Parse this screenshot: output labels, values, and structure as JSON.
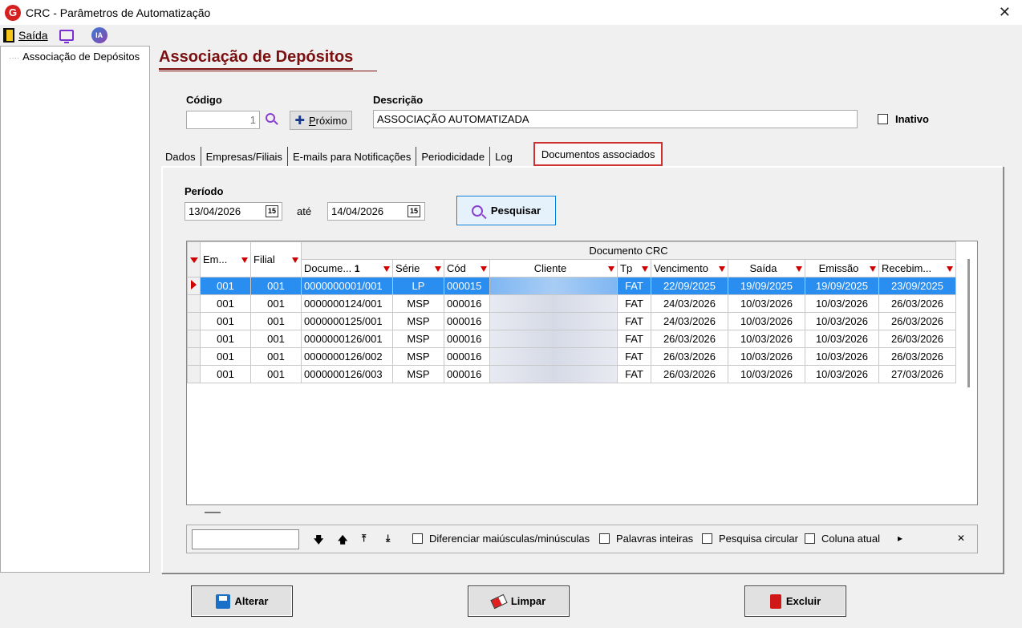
{
  "window": {
    "logo": "G",
    "title": "CRC - Parâmetros de Automatização",
    "close_glyph": "✕"
  },
  "menubar": {
    "exit_label": "Saída",
    "ia_label": "IA"
  },
  "tree": {
    "items": [
      "Associação de Depósitos"
    ]
  },
  "page_title": "Associação de Depósitos",
  "form": {
    "codigo_label": "Código",
    "codigo_value": "1",
    "proximo_label": "Próximo",
    "descricao_label": "Descrição",
    "descricao_value": "ASSOCIAÇÃO AUTOMATIZADA",
    "inativo_label": "Inativo",
    "inativo_checked": false
  },
  "tabs": [
    {
      "label": "Dados",
      "active": false
    },
    {
      "label": "Empresas/Filiais",
      "active": false
    },
    {
      "label": "E-mails para Notificações",
      "active": false
    },
    {
      "label": "Periodicidade",
      "active": false
    },
    {
      "label": "Log",
      "active": false
    },
    {
      "label": "Documentos associados",
      "active": true
    }
  ],
  "period": {
    "label": "Período",
    "from": "13/04/2026",
    "to_label": "até",
    "to": "14/04/2026",
    "calendar_glyph": "15",
    "search_button": "Pesquisar"
  },
  "grid": {
    "group_header": "Documento CRC",
    "sort_glyph": "1",
    "columns": [
      "Em...",
      "Filial",
      "Docume...",
      "Série",
      "Cód",
      "Cliente",
      "Tp",
      "Vencimento",
      "Saída",
      "Emissão",
      "Recebim..."
    ],
    "rows": [
      {
        "empresa": "001",
        "filial": "001",
        "documento": "0000000001/001",
        "serie": "LP",
        "cod": "000015",
        "cliente": "",
        "tp": "FAT",
        "vencimento": "22/09/2025",
        "saida": "19/09/2025",
        "emissao": "19/09/2025",
        "recebimento": "23/09/2025",
        "selected": true
      },
      {
        "empresa": "001",
        "filial": "001",
        "documento": "0000000124/001",
        "serie": "MSP",
        "cod": "000016",
        "cliente": "",
        "tp": "FAT",
        "vencimento": "24/03/2026",
        "saida": "10/03/2026",
        "emissao": "10/03/2026",
        "recebimento": "26/03/2026",
        "selected": false
      },
      {
        "empresa": "001",
        "filial": "001",
        "documento": "0000000125/001",
        "serie": "MSP",
        "cod": "000016",
        "cliente": "",
        "tp": "FAT",
        "vencimento": "24/03/2026",
        "saida": "10/03/2026",
        "emissao": "10/03/2026",
        "recebimento": "26/03/2026",
        "selected": false
      },
      {
        "empresa": "001",
        "filial": "001",
        "documento": "0000000126/001",
        "serie": "MSP",
        "cod": "000016",
        "cliente": "",
        "tp": "FAT",
        "vencimento": "26/03/2026",
        "saida": "10/03/2026",
        "emissao": "10/03/2026",
        "recebimento": "26/03/2026",
        "selected": false
      },
      {
        "empresa": "001",
        "filial": "001",
        "documento": "0000000126/002",
        "serie": "MSP",
        "cod": "000016",
        "cliente": "",
        "tp": "FAT",
        "vencimento": "26/03/2026",
        "saida": "10/03/2026",
        "emissao": "10/03/2026",
        "recebimento": "26/03/2026",
        "selected": false
      },
      {
        "empresa": "001",
        "filial": "001",
        "documento": "0000000126/003",
        "serie": "MSP",
        "cod": "000016",
        "cliente": "",
        "tp": "FAT",
        "vencimento": "26/03/2026",
        "saida": "10/03/2026",
        "emissao": "10/03/2026",
        "recebimento": "27/03/2026",
        "selected": false
      }
    ]
  },
  "findbar": {
    "input_value": "",
    "nav_glyphs": [
      "🡇",
      "🡅",
      "⤒",
      "⤓"
    ],
    "options": [
      "Diferenciar maiúsculas/minúsculas",
      "Palavras inteiras",
      "Pesquisa circular",
      "Coluna atual"
    ],
    "more_glyph": "▸",
    "close_glyph": "✕"
  },
  "actions": {
    "alterar": "Alterar",
    "limpar": "Limpar",
    "excluir": "Excluir"
  },
  "colors": {
    "title_accent": "#7a1010",
    "selection": "#2a8ef0",
    "filter_icon": "#d00000",
    "active_tab_border": "#d03030"
  }
}
